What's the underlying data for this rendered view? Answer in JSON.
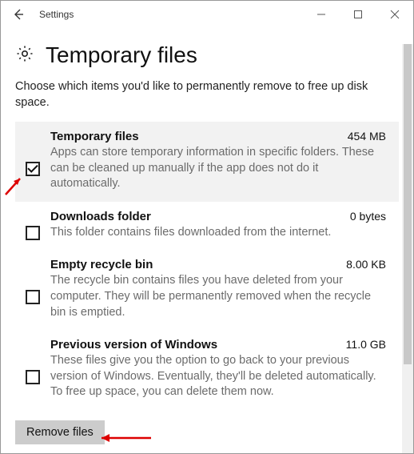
{
  "window": {
    "title": "Settings"
  },
  "page": {
    "title": "Temporary files",
    "intro": "Choose which items you'd like to permanently remove to free up disk space."
  },
  "items": [
    {
      "title": "Temporary files",
      "size": "454 MB",
      "desc": "Apps can store temporary information in specific folders. These can be cleaned up manually if the app does not do it automatically.",
      "checked": true,
      "selected": true
    },
    {
      "title": "Downloads folder",
      "size": "0 bytes",
      "desc": "This folder contains files downloaded from the internet.",
      "checked": false,
      "selected": false
    },
    {
      "title": "Empty recycle bin",
      "size": "8.00 KB",
      "desc": "The recycle bin contains files you have deleted from your computer. They will be permanently removed when the recycle bin is emptied.",
      "checked": false,
      "selected": false
    },
    {
      "title": "Previous version of Windows",
      "size": "11.0 GB",
      "desc": "These files give you the option to go back to your previous version of Windows. Eventually, they'll be deleted automatically. To free up space, you can delete them now.",
      "checked": false,
      "selected": false
    }
  ],
  "actions": {
    "remove_label": "Remove files"
  }
}
